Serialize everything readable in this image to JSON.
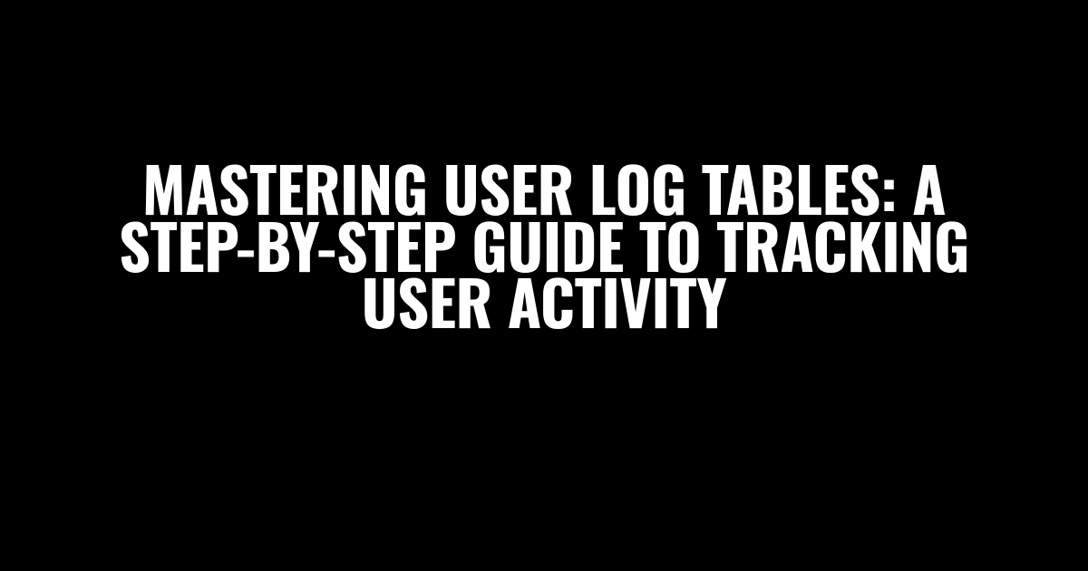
{
  "heading": {
    "text": "Mastering User Log Tables: A Step-by-Step Guide to Tracking User Activity"
  }
}
